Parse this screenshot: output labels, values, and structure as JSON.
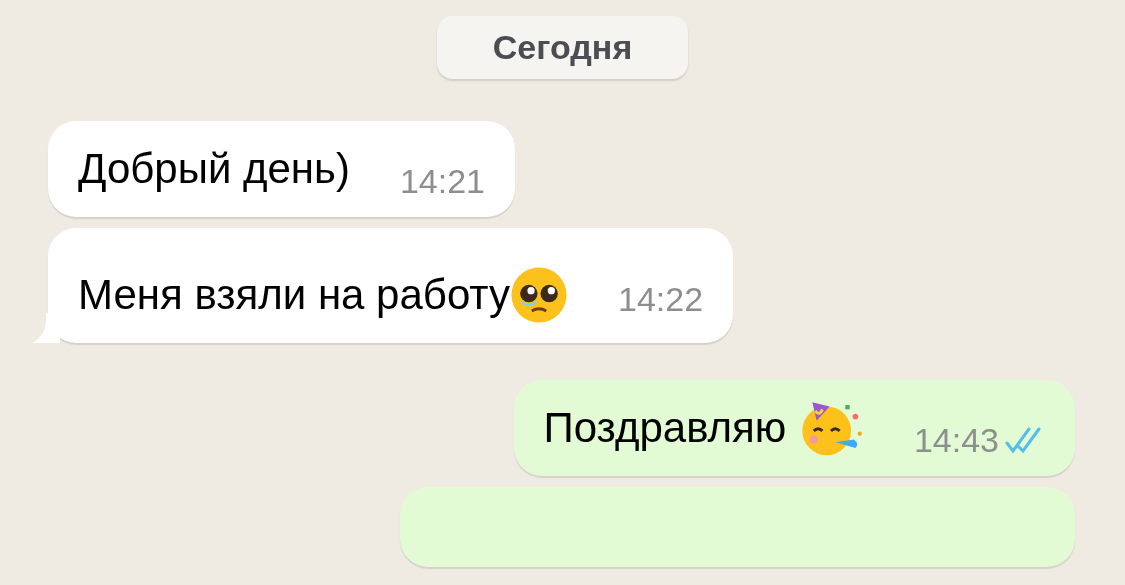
{
  "date_divider": {
    "label": "Сегодня"
  },
  "messages": [
    {
      "outgoing": false,
      "text": "Добрый день)",
      "time": "14:21",
      "tail": false
    },
    {
      "outgoing": false,
      "text": "Меня взяли на работу",
      "emoji": {
        "kind": "pleading"
      },
      "time": "14:22",
      "tail": true
    },
    {
      "outgoing": true,
      "text": "Поздравляю ",
      "emoji": {
        "kind": "party"
      },
      "time": "14:43",
      "read": true,
      "tail": false
    },
    {
      "outgoing": true,
      "tail": false
    }
  ]
}
